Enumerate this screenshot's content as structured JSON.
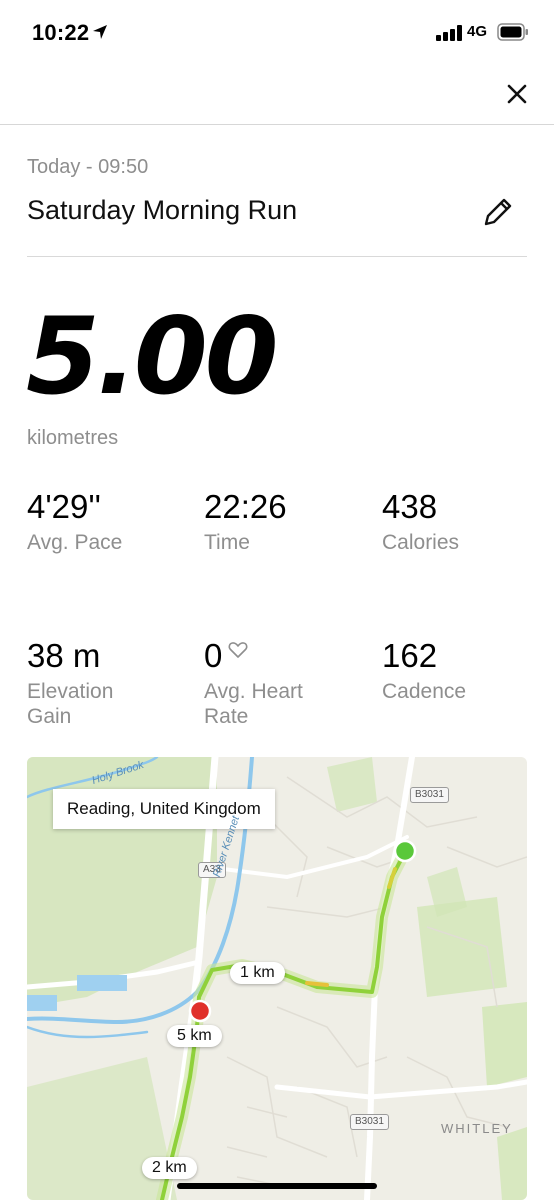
{
  "status_bar": {
    "time": "10:22",
    "network": "4G"
  },
  "activity": {
    "date_label": "Today - 09:50",
    "title": "Saturday Morning Run",
    "distance": "5.00",
    "distance_unit": "kilometres"
  },
  "stats": [
    {
      "value": "4'29''",
      "label": "Avg. Pace"
    },
    {
      "value": "22:26",
      "label": "Time"
    },
    {
      "value": "438",
      "label": "Calories"
    },
    {
      "value": "38 m",
      "label": "Elevation Gain"
    },
    {
      "value": "0",
      "label": "Avg. Heart Rate"
    },
    {
      "value": "162",
      "label": "Cadence"
    }
  ],
  "map": {
    "location": "Reading, United Kingdom",
    "km_markers": [
      "1 km",
      "5 km",
      "2 km"
    ],
    "road_labels": [
      "B3031",
      "A33",
      "B3031"
    ],
    "area_label": "WHITLEY",
    "water_labels": [
      "Holy Brook",
      "River Kennet"
    ]
  },
  "colors": {
    "route": "#8fd13a",
    "start": "#5ac83a",
    "finish": "#e0302a",
    "label_grey": "#8e8e8e"
  }
}
